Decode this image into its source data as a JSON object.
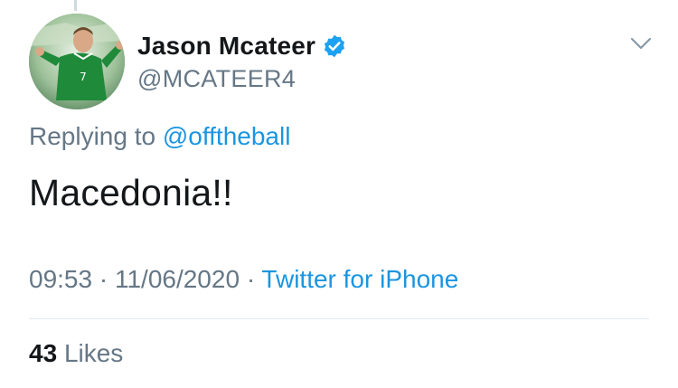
{
  "author": {
    "display_name": "Jason Mcateer",
    "handle": "@MCATEER4",
    "verified": true,
    "avatar_icon": "profile-photo-footballer-green-jersey"
  },
  "reply": {
    "prefix": "Replying to",
    "mention": "@offtheball"
  },
  "tweet": {
    "text": "Macedonia!!"
  },
  "meta": {
    "time": "09:53",
    "separator": "·",
    "date": "11/06/2020",
    "source": "Twitter for iPhone"
  },
  "stats": {
    "likes_count": "43",
    "likes_label": "Likes"
  },
  "colors": {
    "link_blue": "#1b95e0",
    "secondary_text": "#657786",
    "primary_text": "#14171a",
    "divider": "#e1e8ed",
    "verified_badge": "#1da1f2"
  }
}
